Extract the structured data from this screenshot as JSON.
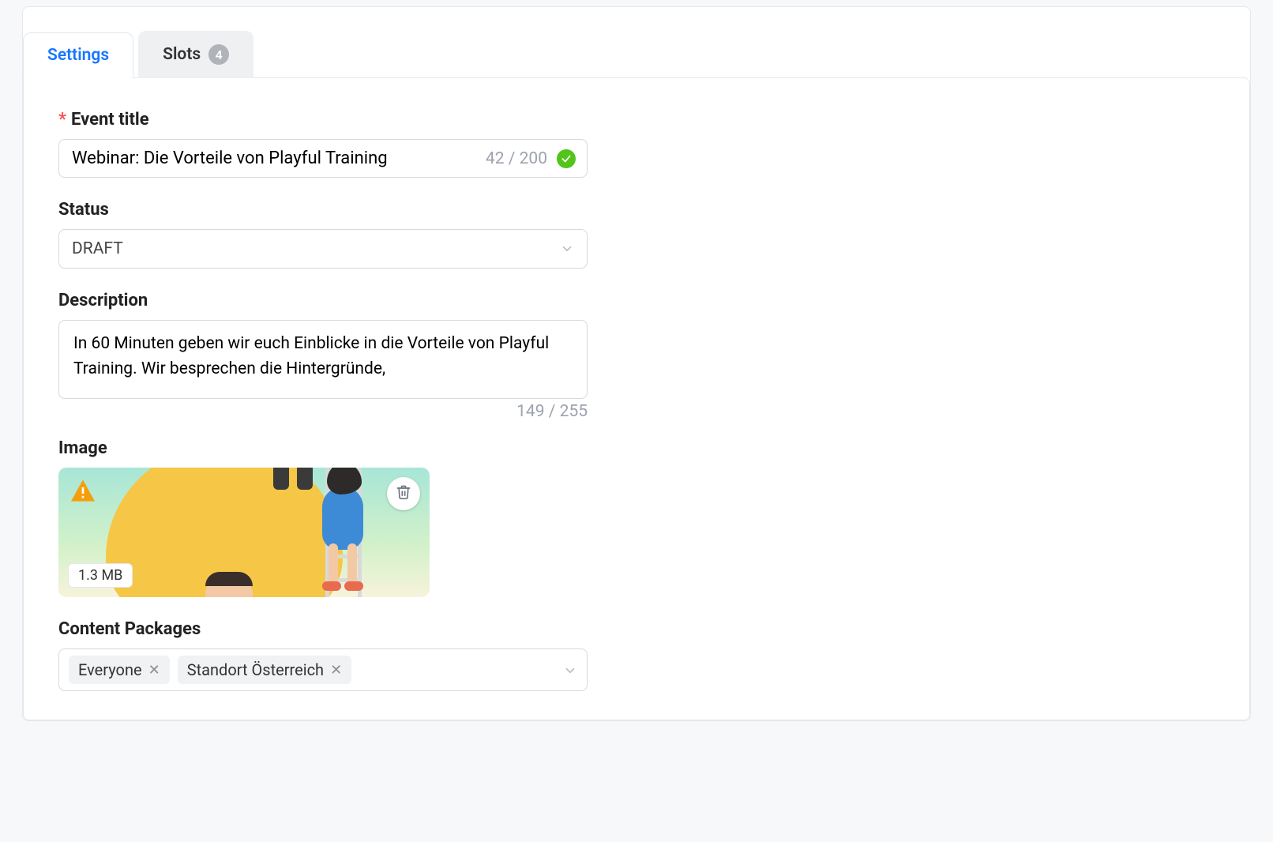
{
  "tabs": {
    "settings_label": "Settings",
    "slots_label": "Slots",
    "slots_count": "4"
  },
  "form": {
    "event_title": {
      "label": "Event title",
      "required_mark": "*",
      "value": "Webinar: Die Vorteile von Playful Training",
      "counter": "42 / 200"
    },
    "status": {
      "label": "Status",
      "value": "DRAFT"
    },
    "description": {
      "label": "Description",
      "value": "In 60 Minuten geben wir euch Einblicke in die Vorteile von Playful Training. Wir besprechen die Hintergründe,",
      "counter": "149 / 255"
    },
    "image": {
      "label": "Image",
      "size_label": "1.3 MB"
    },
    "content_packages": {
      "label": "Content Packages",
      "tags": [
        {
          "label": "Everyone"
        },
        {
          "label": "Standort Österreich"
        }
      ]
    }
  }
}
